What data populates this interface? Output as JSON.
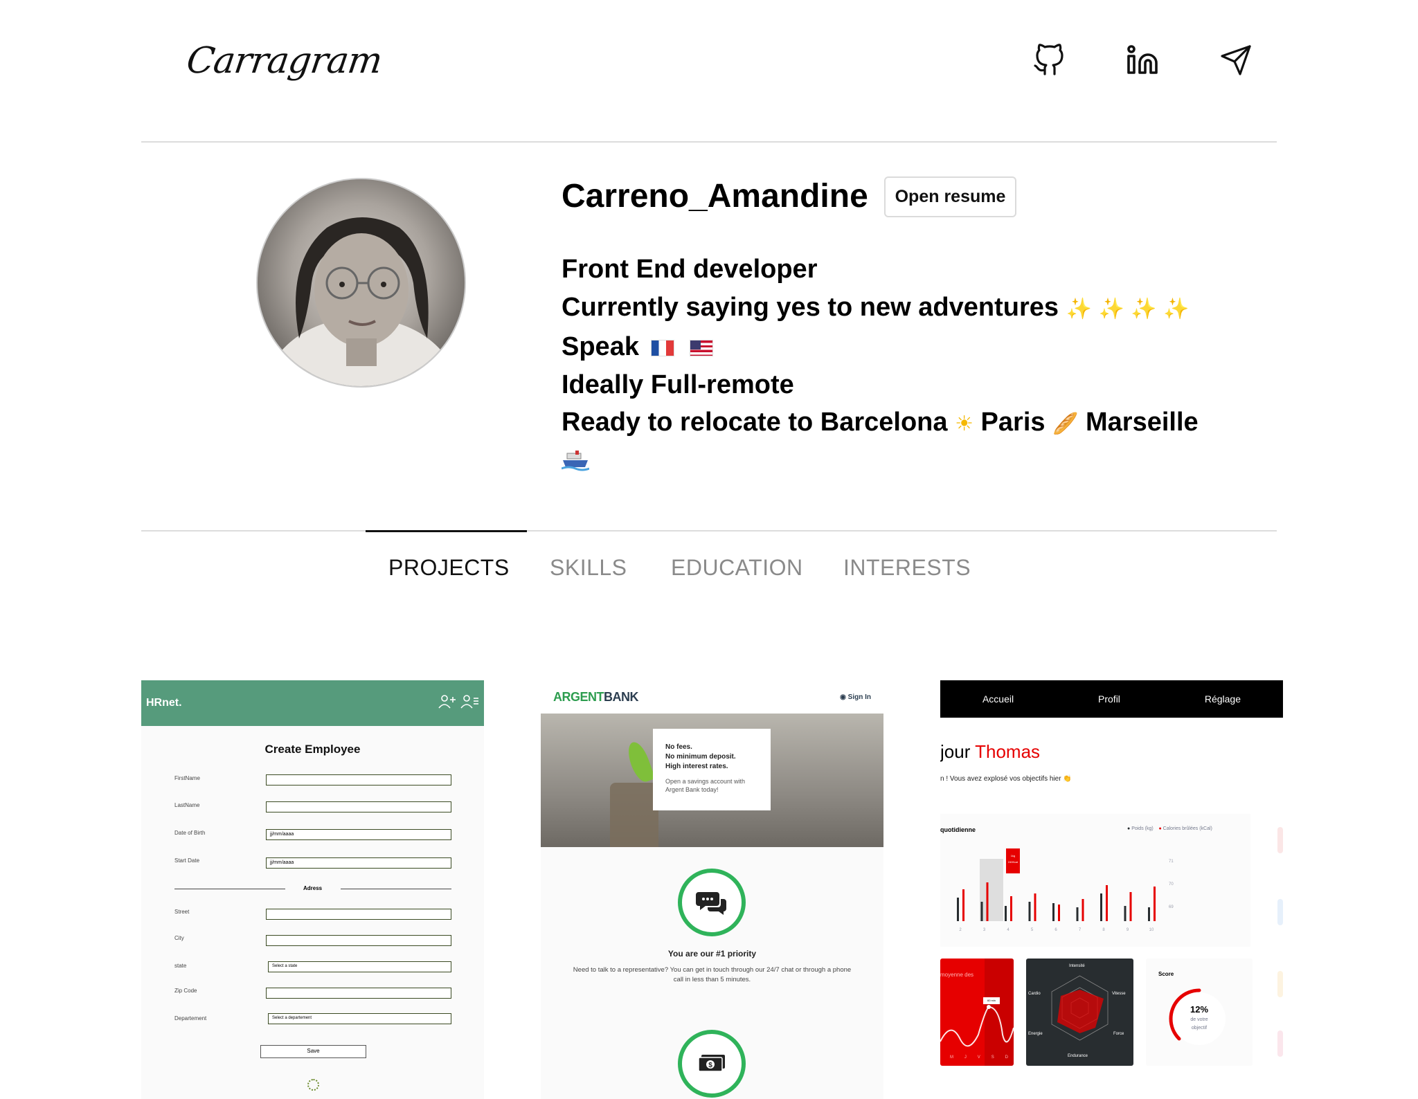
{
  "header": {
    "logo": "Carragram",
    "links": [
      "github-icon",
      "linkedin-icon",
      "send-icon"
    ]
  },
  "profile": {
    "username": "Carreno_Amandine",
    "resume_button": "Open resume",
    "bio": {
      "line1": "Front End developer",
      "line2": "Currently saying yes to new adventures",
      "line2_emoji": "✨ ✨ ✨ ✨",
      "line3": "Speak",
      "line4": "Ideally Full-remote",
      "line5_a": "Ready to relocate to Barcelona",
      "line5_b": "Paris",
      "line5_c": "Marseille"
    }
  },
  "tabs": {
    "projects": "PROJECTS",
    "skills": "SKILLS",
    "education": "EDUCATION",
    "interests": "INTERESTS"
  },
  "projects": {
    "hrnet": {
      "brand": "HRnet.",
      "title": "Create Employee",
      "labels": [
        "FirstName",
        "LastName",
        "Date of Birth",
        "Start Date",
        "Street",
        "City",
        "state",
        "Zip Code",
        "Departement"
      ],
      "date_placeholder": "jj/mm/aaaa",
      "address_legend": "Adress",
      "state_select": "Select a state",
      "department_select": "Select a departement",
      "save": "Save"
    },
    "argentbank": {
      "logo_a": "ARGENT",
      "logo_b": "BANK",
      "signin": "Sign In",
      "hero_line1": "No fees.",
      "hero_line2": "No minimum deposit.",
      "hero_line3": "High interest rates.",
      "hero_sub": "Open a savings account with Argent Bank today!",
      "feature_title": "You are our #1 priority",
      "feature_text": "Need to talk to a representative? You can get in touch through our 24/7 chat or through a phone call in less than 5 minutes."
    },
    "sportsee": {
      "nav": [
        "Accueil",
        "Profil",
        "Réglage"
      ],
      "greeting_a": "jour",
      "greeting_b": "Thomas",
      "subline": "n ! Vous avez explosé vos objectifs hier 👏",
      "activity_title": "quotidienne",
      "legend_weight": "Poids (kg)",
      "legend_cal": "Calories brûlées (kCal)",
      "x_ticks": [
        "2",
        "3",
        "4",
        "5",
        "6",
        "7",
        "8",
        "9",
        "10"
      ],
      "y_ticks": [
        "71",
        "70",
        "69"
      ],
      "tooltip_kg": "1kg",
      "tooltip_kcal": "240Kcal",
      "sessions_title": "moyenne des",
      "sessions_days": [
        "M",
        "J",
        "V",
        "S",
        "D"
      ],
      "sessions_tooltip": "60 min",
      "radar_labels": [
        "Intensité",
        "Vitesse",
        "Force",
        "Endurance",
        "Energie",
        "Cardio"
      ],
      "score_title": "Score",
      "score_value": "12%",
      "score_sub1": "de votre",
      "score_sub2": "objectif"
    }
  },
  "colors": {
    "tab_active": "#111111",
    "tab_inactive": "#8a8a8a",
    "hrnet_green": "#569b7c",
    "argent_green": "#2fb35a",
    "sportsee_red": "#e60000"
  }
}
